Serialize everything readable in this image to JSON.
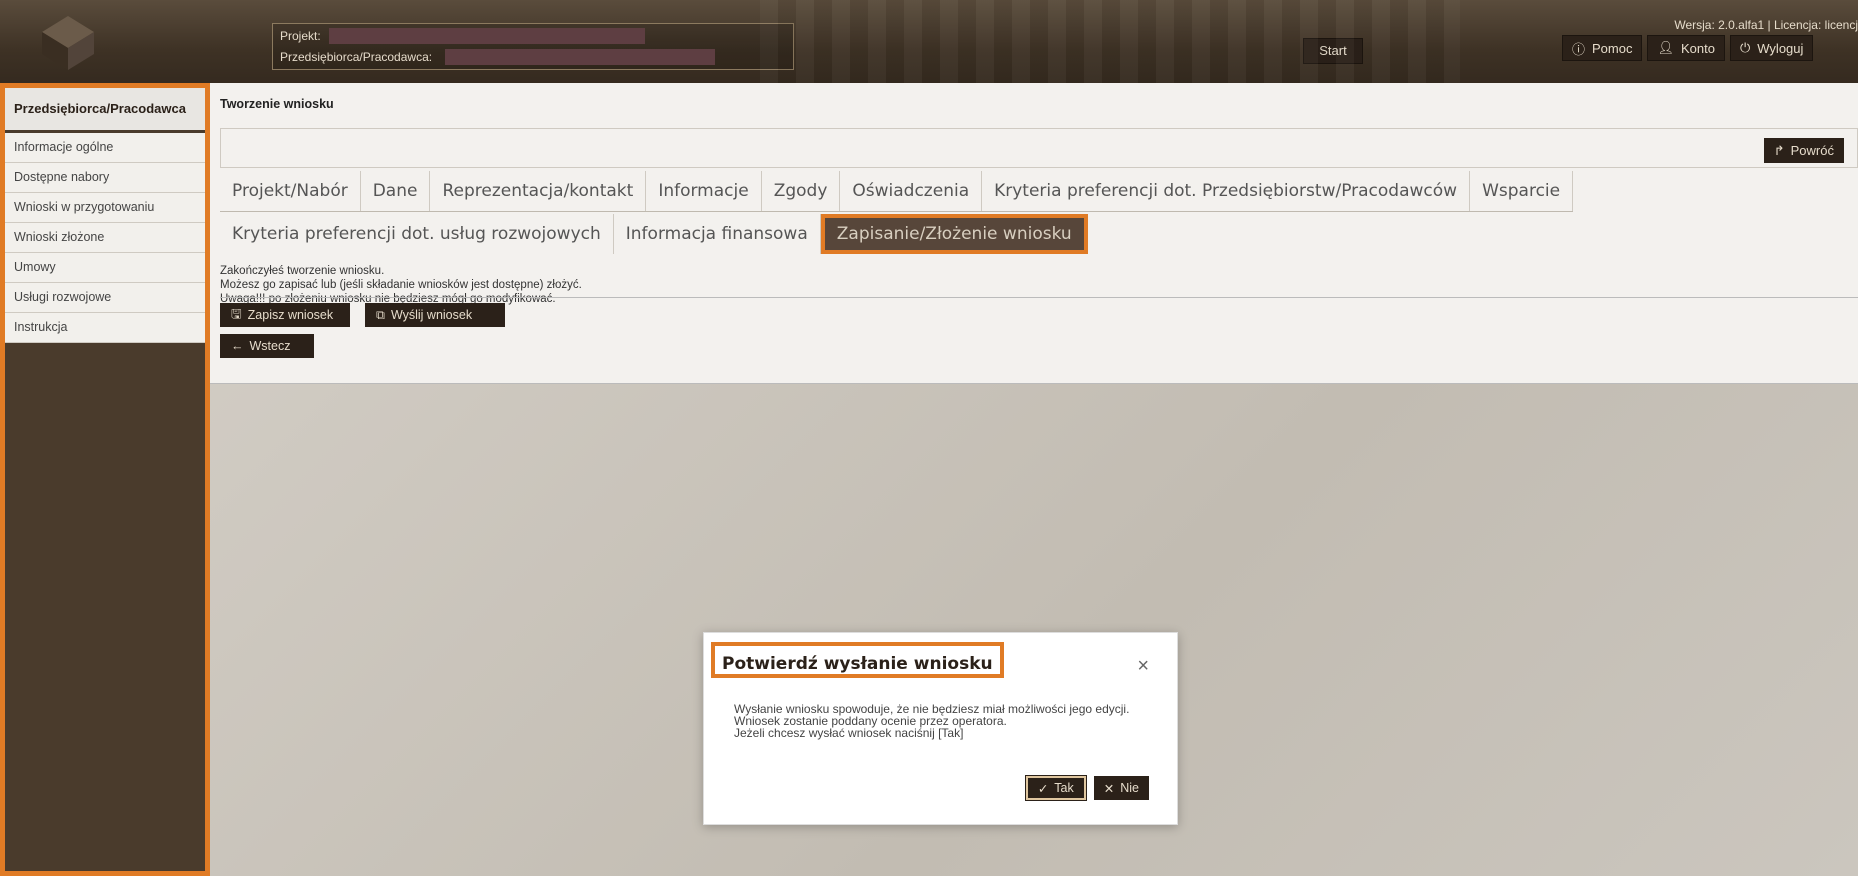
{
  "header": {
    "project_label": "Projekt:",
    "employer_label": "Przedsiębiorca/Pracodawca:",
    "start_label": "Start",
    "version_text": "Wersja: 2.0.alfa1 | Licencja: licencj",
    "buttons": [
      {
        "icon": "info-icon",
        "label": "Pomoc"
      },
      {
        "icon": "user-icon",
        "label": "Konto"
      },
      {
        "icon": "power-icon",
        "label": "Wyloguj"
      }
    ]
  },
  "sidebar": {
    "title": "Przedsiębiorca/Pracodawca",
    "items": [
      {
        "label": "Informacje ogólne"
      },
      {
        "label": "Dostępne nabory"
      },
      {
        "label": "Wnioski w przygotowaniu"
      },
      {
        "label": "Wnioski złożone"
      },
      {
        "label": "Umowy"
      },
      {
        "label": "Usługi rozwojowe"
      },
      {
        "label": "Instrukcja"
      }
    ]
  },
  "main": {
    "breadcrumb": "Tworzenie wniosku",
    "back_label": "Powróć",
    "tabs_row1": [
      "Projekt/Nabór",
      "Dane",
      "Reprezentacja/kontakt",
      "Informacje",
      "Zgody",
      "Oświadczenia",
      "Kryteria preferencji dot. Przedsiębiorstw/Pracodawców",
      "Wsparcie"
    ],
    "tabs_row2": [
      "Kryteria preferencji dot. usług rozwojowych",
      "Informacja finansowa",
      "Zapisanie/Złożenie wniosku"
    ],
    "active_tab": "Zapisanie/Złożenie wniosku",
    "info_lines": [
      "Zakończyłeś tworzenie wniosku.",
      "Możesz go zapisać lub (jeśli składanie wniosków jest dostępne) złożyć.",
      "Uwaga!!! po złożeniu wniosku nie będziesz mógł go modyfikować."
    ],
    "save_label": "Zapisz wniosek",
    "send_label": "Wyślij wniosek",
    "wstecz_label": "Wstecz"
  },
  "modal": {
    "title": "Potwierdź wysłanie wniosku",
    "close_glyph": "×",
    "lines": [
      "Wysłanie wniosku spowoduje, że nie będziesz miał możliwości jego edycji.",
      "Wniosek zostanie poddany ocenie przez operatora.",
      "Jeżeli chcesz wysłać wniosek naciśnij [Tak]"
    ],
    "yes_label": "Tak",
    "no_label": "Nie"
  },
  "colors": {
    "accent": "#e07b25",
    "dark_button": "#2b2119",
    "header_bg": "#3e3225"
  }
}
